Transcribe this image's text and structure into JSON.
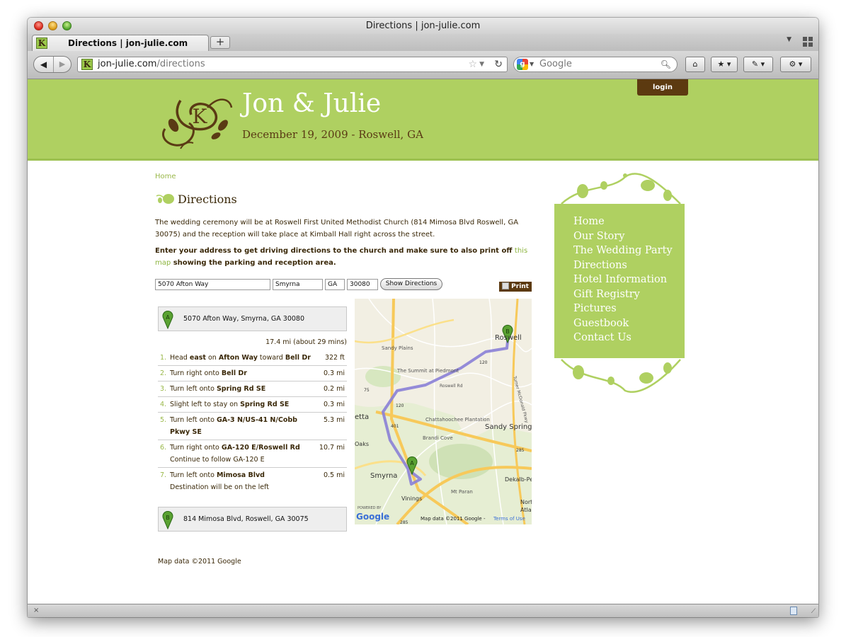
{
  "window": {
    "title": "Directions | jon-julie.com"
  },
  "tab": {
    "title": "Directions | jon-julie.com",
    "favicon_letter": "K"
  },
  "toolbar": {
    "back_icon": "back-arrow-icon",
    "forward_icon": "forward-arrow-icon",
    "url_host": "jon-julie.com",
    "url_path": "/directions",
    "search_placeholder": "Google",
    "new_tab_label": "+"
  },
  "site": {
    "title": "Jon & Julie",
    "date": "December 19, 2009 - Roswell, GA",
    "monogram_letter": "K",
    "login_label": "login",
    "brand_green": "#afd061",
    "brand_brown": "#5c3a10"
  },
  "page": {
    "breadcrumb": "Home",
    "title": "Directions",
    "intro": "The wedding ceremony will be at Roswell First United Methodist Church (814 Mimosa Blvd Roswell, GA 30075) and the reception will take place at Kimball Hall right across the street.",
    "instruct_pre": "Enter your address to get driving directions to the church and make sure to also print off ",
    "instruct_link": "this map",
    "instruct_post": " showing the parking and reception area."
  },
  "form": {
    "street": "5070 Afton Way",
    "city": "Smyrna",
    "state": "GA",
    "zip": "30080",
    "button_label": "Show Directions",
    "print_label": "Print"
  },
  "directions": {
    "start_marker": "A",
    "start_address": "5070 Afton Way, Smyrna, GA 30080",
    "total": "17.4 mi (about 29 mins)",
    "end_marker": "B",
    "end_address": "814 Mimosa Blvd, Roswell, GA 30075",
    "credit": "Map data ©2011 Google",
    "steps": [
      {
        "num": "1.",
        "pre": "Head ",
        "b1": "east",
        "mid": " on ",
        "b2": "Afton Way",
        "post": " toward ",
        "b3": "Bell Dr",
        "note": "",
        "dist": "322 ft"
      },
      {
        "num": "2.",
        "pre": "Turn right onto ",
        "b1": "Bell Dr",
        "mid": "",
        "b2": "",
        "post": "",
        "b3": "",
        "note": "",
        "dist": "0.3 mi"
      },
      {
        "num": "3.",
        "pre": "Turn left onto ",
        "b1": "Spring Rd SE",
        "mid": "",
        "b2": "",
        "post": "",
        "b3": "",
        "note": "",
        "dist": "0.2 mi"
      },
      {
        "num": "4.",
        "pre": "Slight left to stay on ",
        "b1": "Spring Rd SE",
        "mid": "",
        "b2": "",
        "post": "",
        "b3": "",
        "note": "",
        "dist": "0.3 mi"
      },
      {
        "num": "5.",
        "pre": "Turn left onto ",
        "b1": "GA-3 N/US-41 N/Cobb Pkwy SE",
        "mid": "",
        "b2": "",
        "post": "",
        "b3": "",
        "note": "",
        "dist": "5.3 mi"
      },
      {
        "num": "6.",
        "pre": "Turn right onto ",
        "b1": "GA-120 E/Roswell Rd",
        "mid": "",
        "b2": "",
        "post": "",
        "b3": "",
        "note": "Continue to follow GA-120 E",
        "dist": "10.7 mi"
      },
      {
        "num": "7.",
        "pre": "Turn left onto ",
        "b1": "Mimosa Blvd",
        "mid": "",
        "b2": "",
        "post": "",
        "b3": "",
        "note": "Destination will be on the left",
        "dist": "0.5 mi"
      }
    ]
  },
  "map": {
    "labels": {
      "roswell": "Roswell",
      "sandy_plains": "Sandy Plains",
      "summit": "The Summit at Piedmont",
      "roswell_rd": "Roswell Rd",
      "etta": "etta",
      "chatt": "Chattahoochee Plantation",
      "sandy_springs": "Sandy Springs",
      "brandi_cove": "Brandi Cove",
      "oaks": "Oaks",
      "smyrna": "Smyrna",
      "vinings": "Vinings",
      "mt_paran": "Mt Paran",
      "dekalb": "Dekalb-Pe",
      "atla": "Atla",
      "north": "North",
      "turner": "Turner McDonald Pkwy",
      "r120a": "120",
      "r120b": "120",
      "r401": "401",
      "r75": "75",
      "r285a": "285",
      "r285b": "285",
      "powered_by": "POWERED BY",
      "google": "Google",
      "map_data": "Map data ©2011 Google - ",
      "terms": "Terms of Use"
    },
    "route_color": "#8a7fd6"
  },
  "sidebar": {
    "items": [
      "Home",
      "Our Story",
      "The Wedding Party",
      "Directions",
      "Hotel Information",
      "Gift Registry",
      "Pictures",
      "Guestbook",
      "Contact Us"
    ]
  },
  "statusbar": {
    "close_label": "×"
  }
}
